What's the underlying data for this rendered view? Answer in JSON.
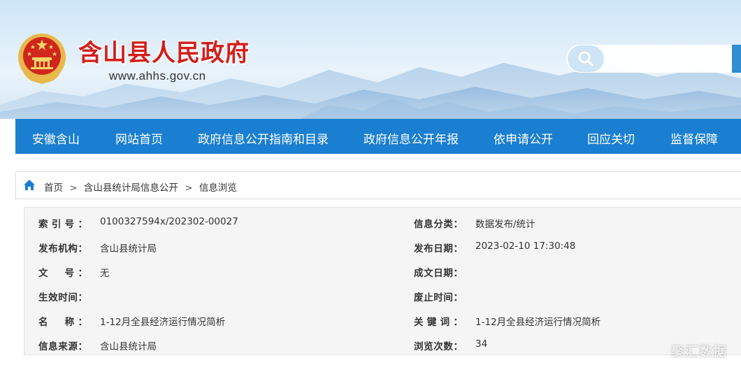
{
  "header": {
    "site_title": "含山县人民政府",
    "site_url": "www.ahhs.gov.cn",
    "search": {
      "placeholder": ""
    }
  },
  "nav": {
    "items": [
      {
        "label": "安徽含山"
      },
      {
        "label": "网站首页"
      },
      {
        "label": "政府信息公开指南和目录"
      },
      {
        "label": "政府信息公开年报"
      },
      {
        "label": "依申请公开"
      },
      {
        "label": "回应关切"
      },
      {
        "label": "监督保障"
      }
    ]
  },
  "breadcrumb": {
    "items": [
      "首页",
      "含山县统计局信息公开",
      "信息浏览"
    ],
    "separator": ">"
  },
  "info": {
    "rows": [
      {
        "left_label": "索引号：",
        "left_value": "0100327594x/202302-00027",
        "right_label": "信息分类：",
        "right_value": "数据发布/统计"
      },
      {
        "left_label": "发布机构：",
        "left_value": "含山县统计局",
        "right_label": "发布日期：",
        "right_value": "2023-02-10 17:30:48"
      },
      {
        "left_label": "文　号：",
        "left_value": "无",
        "right_label": "成文日期：",
        "right_value": ""
      },
      {
        "left_label": "生效时间：",
        "left_value": "",
        "right_label": "废止时间：",
        "right_value": ""
      },
      {
        "left_label": "名　称：",
        "left_value": "1-12月全县经济运行情况简析",
        "right_label": "关键词：",
        "right_value": "1-12月全县经济运行情况简析"
      },
      {
        "left_label": "信息来源：",
        "left_value": "含山县统计局",
        "right_label": "浏览次数：",
        "right_value": "34"
      }
    ]
  },
  "watermark": "聚汇数据",
  "colors": {
    "nav_bg": "#1a7fd1",
    "title_red": "#d21f1b",
    "panel_bg": "#f5f5f5"
  }
}
